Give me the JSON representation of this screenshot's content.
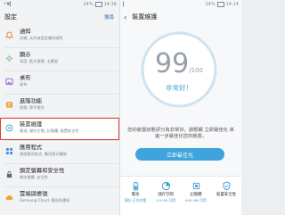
{
  "left": {
    "status": {
      "time": "14:16",
      "signal": "↑▼▎",
      "battery": "24%"
    },
    "title": "設定",
    "search": "搜尋",
    "items": [
      {
        "icon": "bell-icon",
        "title": "通知",
        "sub": "封鎖, 允許或設定優先順序",
        "color": "#e67e22"
      },
      {
        "icon": "display-icon",
        "title": "顯示",
        "sub": "亮度, 藍光濾鏡, 主畫面",
        "color": "#5cb85c"
      },
      {
        "icon": "wallpaper-icon",
        "title": "桌布",
        "sub": "桌布",
        "color": "#8e5bd0"
      },
      {
        "icon": "advanced-features-icon",
        "title": "進階功能",
        "sub": "遊戲, 單手操作",
        "color": "#e8a33c"
      },
      {
        "icon": "device-maintenance-icon",
        "title": "裝置維護",
        "sub": "電池, 儲存空間, 記憶體, 裝置安全性",
        "color": "#3aa0b8"
      },
      {
        "icon": "apps-icon",
        "title": "應用程式",
        "sub": "預設應用程式, 應用程式權限",
        "color": "#4a90d9"
      },
      {
        "icon": "lock-icon",
        "title": "鎖定螢幕和安全性",
        "sub": "鎖定螢幕, 安全性",
        "color": "#5b6a78"
      },
      {
        "icon": "cloud-icon",
        "title": "雲端與帳號",
        "sub": "Samsung Cloud, 備份與還原",
        "color": "#f0a030"
      }
    ]
  },
  "right": {
    "status": {
      "time": "14:14",
      "signal": "▎",
      "battery": "24%"
    },
    "title": "裝置維護",
    "score": "99",
    "max": "/100",
    "verdict": "非常好！",
    "desc": "您的裝置狀態評分為非常好。請輕觸 立即最佳化 來進一步最佳化您的裝置。",
    "button": "立即最佳化",
    "bottom": [
      {
        "icon": "battery-icon",
        "label": "電池",
        "sub": "預計 正在充電",
        "color": "#3a9bd2"
      },
      {
        "icon": "storage-icon",
        "label": "儲存空間",
        "sub": "3.9 GB 可用",
        "color": "#3a9bd2"
      },
      {
        "icon": "memory-icon",
        "label": "記憶體",
        "sub": "645 MB 可用",
        "color": "#3a9bd2"
      },
      {
        "icon": "security-icon",
        "label": "裝置安全性",
        "sub": "",
        "color": "#3a9bd2"
      }
    ]
  },
  "colors": {
    "accent": "#3fa3dc",
    "highlight": "#e03b30",
    "ring": "#cfe3ef",
    "verdict": "#3ca6cc"
  }
}
